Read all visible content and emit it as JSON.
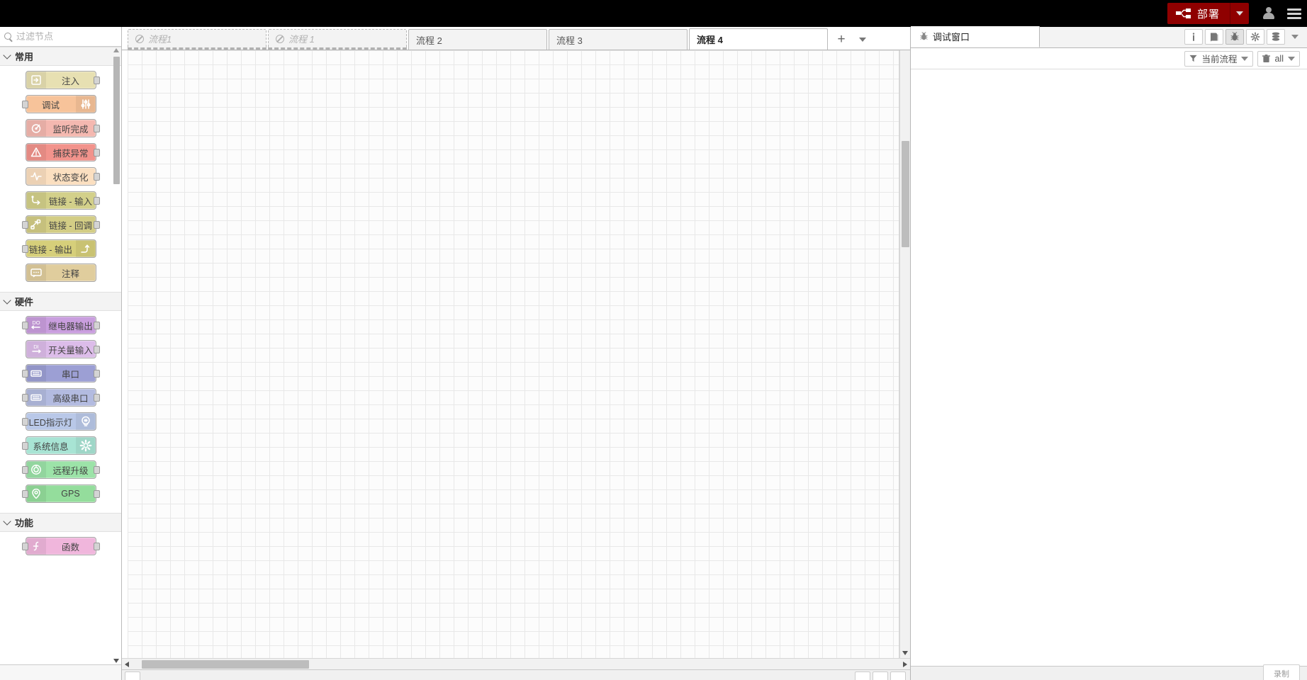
{
  "header": {
    "deploy_label": "部署",
    "deploy_color": "#8f0000",
    "user_icon": "user-icon",
    "menu_icon": "hamburger-menu-icon"
  },
  "palette": {
    "search": {
      "placeholder": "过滤节点",
      "value": ""
    },
    "categories": [
      {
        "name": "常用",
        "nodes": [
          {
            "label": "注入",
            "icon": "inject-icon",
            "color": "#e7e0b2",
            "icon_side": "left",
            "in": false,
            "out": true
          },
          {
            "label": "调试",
            "icon": "debug-sliders-icon",
            "color": "#f7c39a",
            "icon_side": "right",
            "in": true,
            "out": false
          },
          {
            "label": "监听完成",
            "icon": "complete-icon",
            "color": "#f4b8b0",
            "icon_side": "left",
            "in": false,
            "out": true
          },
          {
            "label": "捕获异常",
            "icon": "warning-icon",
            "color": "#f2938c",
            "icon_side": "left",
            "in": false,
            "out": true
          },
          {
            "label": "状态变化",
            "icon": "pulse-icon",
            "color": "#fbdfc0",
            "icon_side": "left",
            "in": false,
            "out": true
          },
          {
            "label": "链接 - 输入",
            "icon": "link-in-icon",
            "color": "#d3d08a",
            "icon_side": "left",
            "in": false,
            "out": true
          },
          {
            "label": "链接 - 回调",
            "icon": "link-call-icon",
            "color": "#d3cd85",
            "icon_side": "left",
            "in": true,
            "out": true
          },
          {
            "label": "链接 - 输出",
            "icon": "link-out-icon",
            "color": "#d6cf7a",
            "icon_side": "right",
            "in": true,
            "out": false
          },
          {
            "label": "注释",
            "icon": "comment-icon",
            "color": "#e0cd9d",
            "icon_side": "left",
            "in": false,
            "out": false
          }
        ]
      },
      {
        "name": "硬件",
        "nodes": [
          {
            "label": "继电器输出",
            "icon": "do-relay-icon",
            "color": "#c99ede",
            "icon_side": "left",
            "in": true,
            "out": true
          },
          {
            "label": "开关量输入",
            "icon": "di-switch-icon",
            "color": "#dcbce9",
            "icon_side": "left",
            "in": false,
            "out": true
          },
          {
            "label": "串口",
            "icon": "serial-port-icon",
            "color": "#9c9fd4",
            "icon_side": "left",
            "in": true,
            "out": true
          },
          {
            "label": "高级串口",
            "icon": "serial-adv-icon",
            "color": "#b3bbe0",
            "icon_side": "left",
            "in": true,
            "out": true
          },
          {
            "label": "LED指示灯",
            "icon": "led-lamp-icon",
            "color": "#b9c8e8",
            "icon_side": "right",
            "in": true,
            "out": false
          },
          {
            "label": "系统信息",
            "icon": "gear-icon",
            "color": "#a8e4d4",
            "icon_side": "right",
            "in": true,
            "out": false
          },
          {
            "label": "远程升级",
            "icon": "upgrade-icon",
            "color": "#9ce3a8",
            "icon_side": "left",
            "in": true,
            "out": true
          },
          {
            "label": "GPS",
            "icon": "gps-pin-icon",
            "color": "#94dd9c",
            "icon_side": "left",
            "in": true,
            "out": true
          }
        ]
      },
      {
        "name": "功能",
        "nodes": [
          {
            "label": "函数",
            "icon": "function-icon",
            "color": "#f0b6dc",
            "icon_side": "left",
            "in": true,
            "out": true
          }
        ]
      }
    ]
  },
  "workspace": {
    "tabs": [
      {
        "label": "流程1",
        "disabled": true,
        "active": false
      },
      {
        "label": "流程 1",
        "disabled": true,
        "active": false
      },
      {
        "label": "流程 2",
        "disabled": false,
        "active": false
      },
      {
        "label": "流程 3",
        "disabled": false,
        "active": false
      },
      {
        "label": "流程 4",
        "disabled": false,
        "active": true
      }
    ],
    "add_tab_label": "+",
    "tab_menu_icon": "chevron-down-icon"
  },
  "sidebar_right": {
    "tab_label": "调试窗口",
    "tab_icon": "bug-icon",
    "icon_buttons": [
      {
        "name": "info-icon",
        "glyph": "i",
        "active": false
      },
      {
        "name": "help-book-icon",
        "glyph": "📕",
        "active": false
      },
      {
        "name": "debug-bug-icon",
        "glyph": "🐞",
        "active": true
      },
      {
        "name": "config-gear-icon",
        "glyph": "⚙",
        "active": false
      },
      {
        "name": "context-data-icon",
        "glyph": "≡",
        "active": false
      }
    ],
    "expand_icon": "chevron-down-icon",
    "filter_scope": {
      "label": "当前流程",
      "icon": "filter-icon"
    },
    "clear_filter": {
      "label": "all",
      "icon": "trash-icon"
    },
    "messages": [],
    "corner_tab_label": "录制"
  }
}
